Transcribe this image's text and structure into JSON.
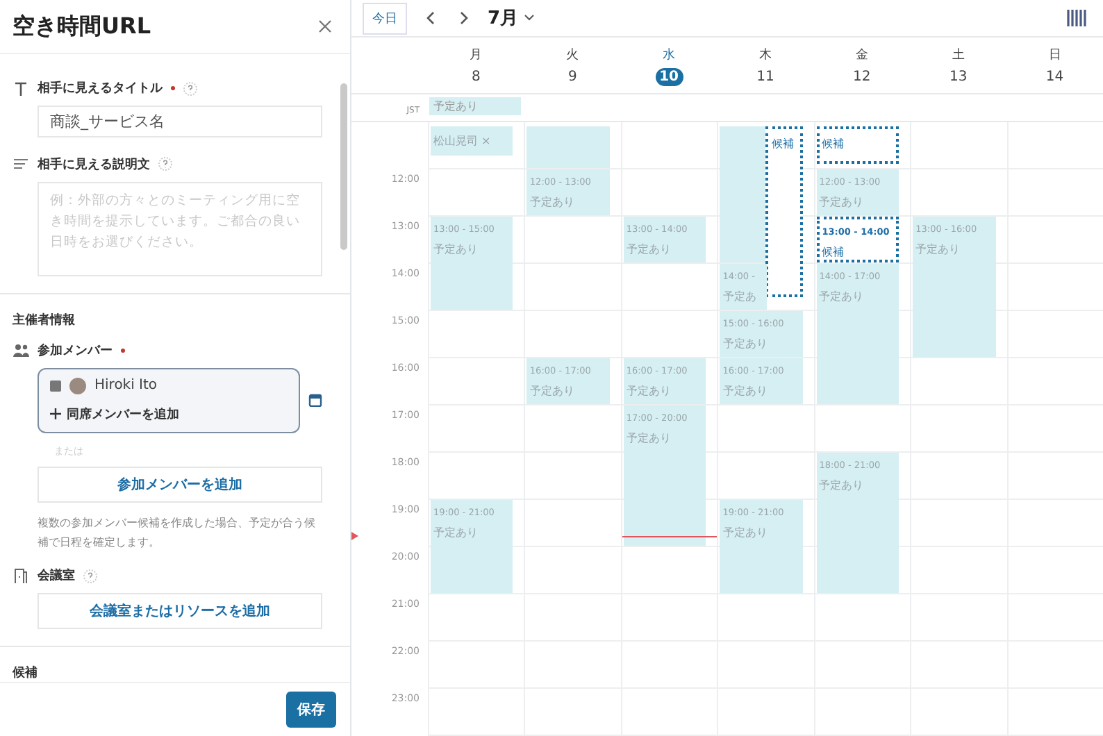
{
  "panel": {
    "title": "空き時間URL",
    "title_field": {
      "label": "相手に見えるタイトル",
      "required": true,
      "value": "商談_サービス名"
    },
    "description_field": {
      "label": "相手に見える説明文",
      "placeholder": "例：外部の方々とのミーティング用に空き時間を提示しています。ご都合の良い日時をお選びください。"
    },
    "organizer_heading": "主催者情報",
    "members": {
      "label": "参加メンバー",
      "required": true,
      "member_name": "Hiroki Ito",
      "add_attendee": "同席メンバーを追加",
      "or_text": "または",
      "add_button": "参加メンバーを追加",
      "help": "複数の参加メンバー候補を作成した場合、予定が合う候補で日程を確定します。"
    },
    "room": {
      "label": "会議室",
      "add_button": "会議室またはリソースを追加"
    },
    "candidates_heading": "候補",
    "save_button": "保存"
  },
  "calendar": {
    "today_button": "今日",
    "month": "7月",
    "timezone": "JST",
    "days": [
      {
        "name": "月",
        "date": "8",
        "selected": false,
        "all_day": [
          {
            "label": "予定あり"
          }
        ],
        "events": [
          {
            "kind": "busy",
            "label": "松山晃司 ×"
          },
          {
            "kind": "busy",
            "time": "13:00 - 15:00",
            "label": "予定あり"
          },
          {
            "kind": "busy",
            "time": "19:00 - 21:00",
            "label": "予定あり"
          }
        ]
      },
      {
        "name": "火",
        "date": "9",
        "selected": false,
        "events": [
          {
            "kind": "busy"
          },
          {
            "kind": "busy",
            "time": "12:00 - 13:00",
            "label": "予定あり"
          },
          {
            "kind": "busy",
            "time": "16:00 - 17:00",
            "label": "予定あり"
          }
        ]
      },
      {
        "name": "水",
        "date": "10",
        "selected": true,
        "events": [
          {
            "kind": "busy",
            "time": "13:00 - 14:00",
            "label": "予定あり"
          },
          {
            "kind": "busy",
            "time": "16:00 - 17:00",
            "label": "予定あり"
          },
          {
            "kind": "busy",
            "time": "17:00 - 20:00",
            "label": "予定あり"
          }
        ]
      },
      {
        "name": "木",
        "date": "11",
        "selected": false,
        "events": [
          {
            "kind": "busy"
          },
          {
            "kind": "candidate",
            "label": "候補"
          },
          {
            "kind": "busy",
            "time": "14:00 -",
            "label": "予定あ"
          },
          {
            "kind": "busy",
            "time": "15:00 - 16:00",
            "label": "予定あり"
          },
          {
            "kind": "busy",
            "time": "16:00 - 17:00",
            "label": "予定あり"
          },
          {
            "kind": "busy",
            "time": "19:00 - 21:00",
            "label": "予定あり"
          }
        ]
      },
      {
        "name": "金",
        "date": "12",
        "selected": false,
        "events": [
          {
            "kind": "candidate",
            "label": "候補"
          },
          {
            "kind": "busy",
            "time": "12:00 - 13:00",
            "label": "予定あり"
          },
          {
            "kind": "candidate",
            "time": "13:00 - 14:00",
            "label": "候補"
          },
          {
            "kind": "busy",
            "time": "14:00 - 17:00",
            "label": "予定あり"
          },
          {
            "kind": "busy",
            "time": "18:00 - 21:00",
            "label": "予定あり"
          }
        ]
      },
      {
        "name": "土",
        "date": "13",
        "selected": false,
        "events": [
          {
            "kind": "busy",
            "time": "13:00 - 16:00",
            "label": "予定あり"
          }
        ]
      },
      {
        "name": "日",
        "date": "14",
        "selected": false
      }
    ],
    "hours": [
      "12:00",
      "13:00",
      "14:00",
      "15:00",
      "16:00",
      "17:00",
      "18:00",
      "19:00",
      "20:00",
      "21:00",
      "22:00",
      "23:00"
    ]
  }
}
